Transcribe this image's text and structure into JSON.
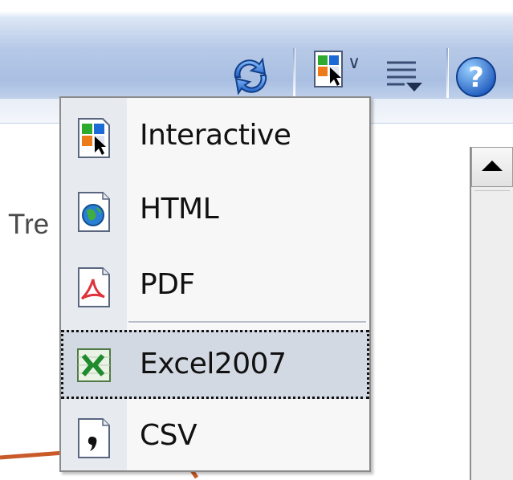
{
  "toolbar": {
    "buttons": [
      {
        "icon": "refresh-icon"
      },
      {
        "icon": "export-icon",
        "has_dropdown": true
      },
      {
        "icon": "list-options-icon"
      },
      {
        "icon": "help-icon"
      }
    ]
  },
  "export_menu": {
    "items": [
      {
        "label": "Interactive",
        "icon": "interactive-export-icon"
      },
      {
        "label": "HTML",
        "icon": "html-export-icon"
      },
      {
        "label": "PDF",
        "icon": "pdf-export-icon"
      },
      {
        "label": "Excel2007",
        "icon": "excel-export-icon",
        "focused": true
      },
      {
        "label": "CSV",
        "icon": "csv-export-icon"
      }
    ]
  },
  "background": {
    "partial_text": "Tre"
  },
  "colors": {
    "toolbar": "#a9bfe2",
    "menu_background": "#f7f7f7",
    "menu_gutter": "#e7ebf0",
    "focused_item": "#d3d9e3",
    "trend_line": "#c95a2a"
  }
}
